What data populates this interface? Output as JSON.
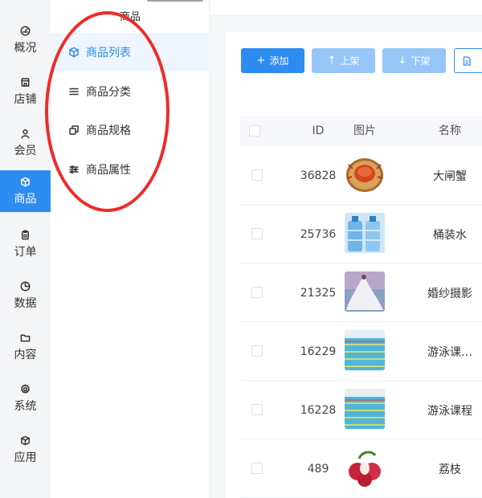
{
  "rail": {
    "items": [
      {
        "label": "概况",
        "icon": "dashboard-icon"
      },
      {
        "label": "店铺",
        "icon": "store-icon"
      },
      {
        "label": "会员",
        "icon": "user-icon"
      },
      {
        "label": "商品",
        "icon": "cube-icon",
        "active": true
      },
      {
        "label": "订单",
        "icon": "clipboard-icon"
      },
      {
        "label": "数据",
        "icon": "pie-chart-icon"
      },
      {
        "label": "内容",
        "icon": "folder-icon"
      },
      {
        "label": "系统",
        "icon": "gear-icon"
      },
      {
        "label": "应用",
        "icon": "cube-icon"
      }
    ]
  },
  "submenu": {
    "title": "商品",
    "items": [
      {
        "label": "商品列表",
        "icon": "cube-icon",
        "active": true
      },
      {
        "label": "商品分类",
        "icon": "list-icon"
      },
      {
        "label": "商品规格",
        "icon": "copy-icon"
      },
      {
        "label": "商品属性",
        "icon": "sliders-icon"
      }
    ]
  },
  "toolbar": {
    "add_label": "添加",
    "on_shelf_label": "上架",
    "off_shelf_label": "下架"
  },
  "table": {
    "columns": [
      "ID",
      "图片",
      "名称"
    ],
    "rows": [
      {
        "id": "36828",
        "name": "大闸蟹"
      },
      {
        "id": "25736",
        "name": "桶装水"
      },
      {
        "id": "21325",
        "name": "婚纱摄影"
      },
      {
        "id": "16229",
        "name": "游泳课…"
      },
      {
        "id": "16228",
        "name": "游泳课程"
      },
      {
        "id": "489",
        "name": "荔枝"
      }
    ]
  },
  "colors": {
    "primary": "#2d8cf0",
    "disabled": "#96c6f8",
    "annotation": "#ee2b2b"
  }
}
